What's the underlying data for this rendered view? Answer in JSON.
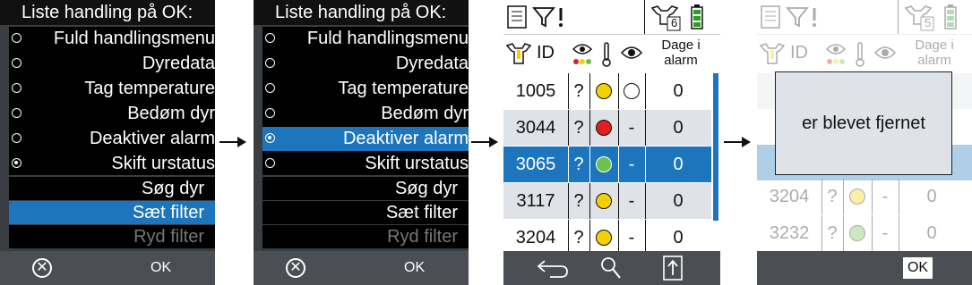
{
  "menu": {
    "title": "Liste handling på OK:",
    "options": [
      "Fuld handlingsmenu",
      "Dyredata",
      "Tag temperature",
      "Bedøm dyr",
      "Deaktiver alarm",
      "Skift urstatus"
    ],
    "actions": [
      "Søg dyr",
      "Sæt filter",
      "Ryd filter"
    ],
    "footer_ok": "OK",
    "footer_cancel_icon": "cancel-circle-icon"
  },
  "list": {
    "badge": "6",
    "header_id": "ID",
    "header_days": [
      "Dage i",
      "alarm"
    ],
    "rows": [
      {
        "id": "1005",
        "q": "?",
        "color": "#f5d000",
        "third": "circle",
        "days": "0"
      },
      {
        "id": "3044",
        "q": "?",
        "color": "#e02020",
        "third": "-",
        "days": "0"
      },
      {
        "id": "3065",
        "q": "?",
        "color": "#6cc24a",
        "third": "-",
        "days": "0"
      },
      {
        "id": "3117",
        "q": "?",
        "color": "#f5d000",
        "third": "-",
        "days": "0"
      },
      {
        "id": "3204",
        "q": "?",
        "color": "#f5d000",
        "third": "-",
        "days": "0"
      }
    ]
  },
  "dimmed": {
    "badge": "5",
    "header_id": "ID",
    "header_days": [
      "Dage i",
      "alarm"
    ],
    "rows": [
      {
        "id": "3204",
        "q": "?",
        "color": "#f5d000",
        "third": "-",
        "days": "0"
      },
      {
        "id": "3232",
        "q": "?",
        "color": "#6cc24a",
        "third": "-",
        "days": "0"
      }
    ],
    "dialog_text": "er blevet fjernet",
    "footer_ok": "OK"
  }
}
